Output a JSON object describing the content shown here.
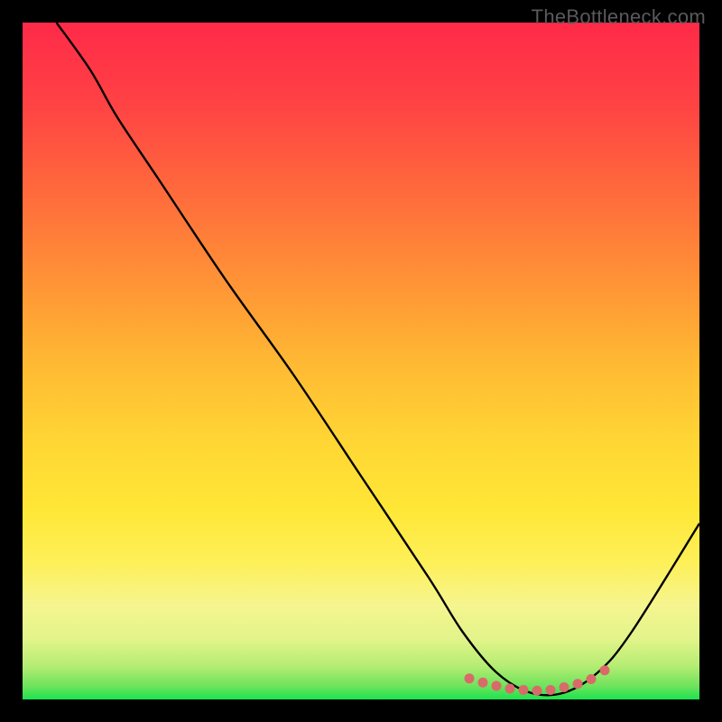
{
  "watermark": "TheBottleneck.com",
  "chart_data": {
    "type": "line",
    "title": "",
    "xlabel": "",
    "ylabel": "",
    "xlim": [
      0,
      100
    ],
    "ylim": [
      0,
      100
    ],
    "grid": false,
    "legend": false,
    "background": {
      "type": "vertical-gradient",
      "stops": [
        {
          "pos": 0.0,
          "color": "#ff2a49"
        },
        {
          "pos": 0.25,
          "color": "#ff6a3c"
        },
        {
          "pos": 0.5,
          "color": "#ffb833"
        },
        {
          "pos": 0.72,
          "color": "#ffe736"
        },
        {
          "pos": 0.86,
          "color": "#f2f59a"
        },
        {
          "pos": 0.95,
          "color": "#c5f17a"
        },
        {
          "pos": 1.0,
          "color": "#1de34f"
        }
      ]
    },
    "series": [
      {
        "name": "bottleneck-curve",
        "color": "#000000",
        "x": [
          5,
          10,
          14,
          20,
          30,
          40,
          50,
          60,
          65,
          70,
          75,
          80,
          85,
          90,
          100
        ],
        "y": [
          100,
          93,
          86,
          77,
          62,
          48,
          33,
          18,
          10,
          4,
          1,
          1,
          4,
          10,
          26
        ]
      }
    ],
    "markers": {
      "name": "optimal-range-dots",
      "color": "#d96a6a",
      "x": [
        66,
        68,
        70,
        72,
        74,
        76,
        78,
        80,
        82,
        84,
        86
      ],
      "y": [
        3.1,
        2.5,
        2.0,
        1.6,
        1.4,
        1.3,
        1.4,
        1.8,
        2.3,
        3.0,
        4.3
      ]
    }
  },
  "colors": {
    "frame": "#000000",
    "watermark": "#5a5a5a",
    "curve": "#000000",
    "marker": "#d96a6a"
  }
}
